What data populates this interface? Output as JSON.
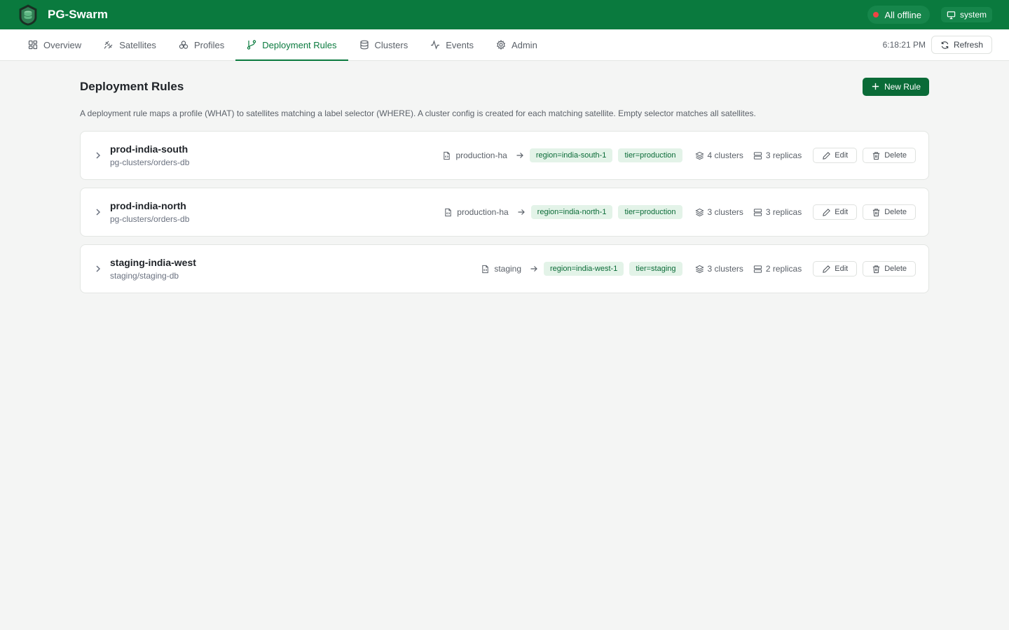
{
  "app": {
    "name": "PG-Swarm"
  },
  "header": {
    "status": "All offline",
    "user": "system"
  },
  "nav": {
    "tabs": [
      {
        "label": "Overview",
        "icon": "grid-icon"
      },
      {
        "label": "Satellites",
        "icon": "satellite-icon"
      },
      {
        "label": "Profiles",
        "icon": "profiles-icon"
      },
      {
        "label": "Deployment Rules",
        "icon": "git-branch-icon"
      },
      {
        "label": "Clusters",
        "icon": "database-icon"
      },
      {
        "label": "Events",
        "icon": "activity-icon"
      },
      {
        "label": "Admin",
        "icon": "gear-icon"
      }
    ],
    "active_tab": "Deployment Rules",
    "time": "6:18:21 PM",
    "refresh_label": "Refresh"
  },
  "page": {
    "title": "Deployment Rules",
    "new_button": "New Rule",
    "description": "A deployment rule maps a profile (WHAT) to satellites matching a label selector (WHERE). A cluster config is created for each matching satellite. Empty selector matches all satellites."
  },
  "rules": [
    {
      "name": "prod-india-south",
      "namespace": "pg-clusters/orders-db",
      "profile": "production-ha",
      "labels": [
        "region=india-south-1",
        "tier=production"
      ],
      "clusters": "4 clusters",
      "replicas": "3 replicas"
    },
    {
      "name": "prod-india-north",
      "namespace": "pg-clusters/orders-db",
      "profile": "production-ha",
      "labels": [
        "region=india-north-1",
        "tier=production"
      ],
      "clusters": "3 clusters",
      "replicas": "3 replicas"
    },
    {
      "name": "staging-india-west",
      "namespace": "staging/staging-db",
      "profile": "staging",
      "labels": [
        "region=india-west-1",
        "tier=staging"
      ],
      "clusters": "3 clusters",
      "replicas": "2 replicas"
    }
  ],
  "row_actions": {
    "edit": "Edit",
    "delete": "Delete"
  },
  "colors": {
    "brand": "#0a7a3e",
    "badge_bg": "#e3f3e8",
    "badge_text": "#0a6b37",
    "offline_dot": "#ef4444"
  }
}
